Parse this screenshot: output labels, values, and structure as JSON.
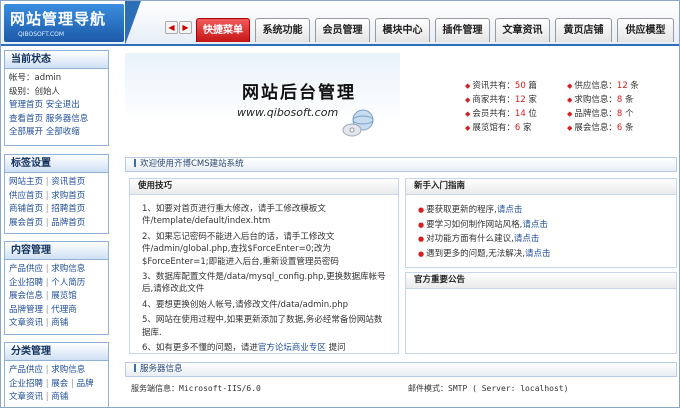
{
  "header": {
    "logo_title": "网站管理导航",
    "logo_subtitle": "QIBOSOFT.COM",
    "tabs": [
      {
        "label": "快捷菜单",
        "active": true
      },
      {
        "label": "系统功能",
        "active": false
      },
      {
        "label": "会员管理",
        "active": false
      },
      {
        "label": "模块中心",
        "active": false
      },
      {
        "label": "插件管理",
        "active": false
      },
      {
        "label": "文章资讯",
        "active": false
      },
      {
        "label": "黄页店铺",
        "active": false
      },
      {
        "label": "供应模型",
        "active": false
      }
    ]
  },
  "sidebar": {
    "status": {
      "title": "当前状态",
      "account": "帐号：admin",
      "level": "级别：创始人",
      "links": [
        "管理首页",
        "安全退出",
        "查看首页",
        "服务器信息",
        "全部展开",
        "全部收缩"
      ]
    },
    "tags": {
      "title": "标签设置",
      "rows": [
        [
          "网站主页",
          "资讯首页"
        ],
        [
          "供应首页",
          "求购首页"
        ],
        [
          "商铺首页",
          "招聘首页"
        ],
        [
          "展会首页",
          "品牌首页"
        ]
      ]
    },
    "content": {
      "title": "内容管理",
      "rows": [
        [
          "产品供应",
          "求购信息"
        ],
        [
          "企业招聘",
          "个人简历"
        ],
        [
          "展会信息",
          "展览馆"
        ],
        [
          "品牌管理",
          "代理商"
        ],
        [
          "文章资讯",
          "商铺"
        ]
      ]
    },
    "category": {
      "title": "分类管理",
      "rows": [
        [
          "产品供应",
          "求购信息"
        ],
        [
          "企业招聘",
          "展会",
          "品牌"
        ],
        [
          "文章资讯",
          "商铺"
        ]
      ]
    }
  },
  "banner": {
    "title": "网站后台管理",
    "url": "www.qibosoft.com",
    "stats_left": [
      {
        "label": "资讯共有：",
        "value": "50",
        "unit": " 篇"
      },
      {
        "label": "商家共有：",
        "value": "12",
        "unit": " 家"
      },
      {
        "label": "会员共有：",
        "value": "14",
        "unit": " 位"
      },
      {
        "label": "展览馆有：",
        "value": "6",
        "unit": " 家"
      }
    ],
    "stats_right": [
      {
        "label": "供应信息：",
        "value": "12",
        "unit": " 条"
      },
      {
        "label": "求购信息：",
        "value": "8",
        "unit": " 条"
      },
      {
        "label": "品牌信息：",
        "value": "8",
        "unit": " 个"
      },
      {
        "label": "展会信息：",
        "value": "6",
        "unit": " 条"
      }
    ]
  },
  "welcome": "欢迎使用齐博CMS建站系统",
  "tips": {
    "title": "使用技巧",
    "items": [
      "1、如要对首页进行重大修改，请手工修改模板文件/template/default/index.htm",
      "2、如果忘记密码不能进入后台的话，请手工修改文件/admin/global.php,查找$ForceEnter=0;改为$ForceEnter=1;即能进入后台,重新设置管理员密码",
      "3、数据库配置文件是/data/mysql_config.php,更换数据库帐号后,请修改此文件",
      "4、要想更换创始人帐号,请修改文件/data/admin.php",
      "5、网站在使用过程中,如果更新添加了数据,务必经常备份网站数据库.",
      "6、如有更多不懂的问题，请进"
    ],
    "last_link": "官方论坛商业专区",
    "last_suffix": " 提问"
  },
  "guide": {
    "title": "新手入门指南",
    "items": [
      {
        "text": "要获取更新的程序,",
        "link": "请点击"
      },
      {
        "text": "要学习如何制作网站风格,",
        "link": "请点击"
      },
      {
        "text": "对功能方面有什么建议,",
        "link": "请点击"
      },
      {
        "text": "遇到更多的问题,无法解决,",
        "link": "请点击"
      }
    ]
  },
  "announcement": {
    "title": "官方重要公告"
  },
  "server": {
    "title": "服务器信息",
    "software": "服务端信息：Microsoft-IIS/6.0",
    "mail": "邮件模式：SMTP ( Server: localhost)"
  }
}
